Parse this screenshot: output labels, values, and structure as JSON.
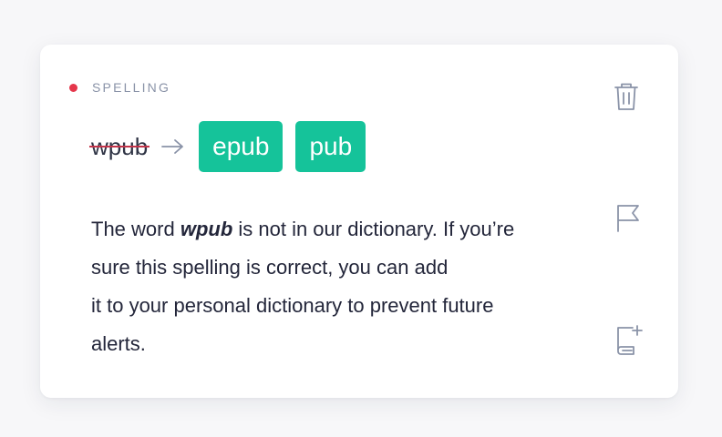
{
  "card": {
    "category": "SPELLING",
    "category_color": "#e5364b",
    "mistake": "wpub",
    "suggestions": [
      "epub",
      "pub"
    ],
    "accent": "#15c39a",
    "message": {
      "before": "The word ",
      "word": "wpub",
      "after_line1": " is not in our dictionary. If you’re",
      "line2": "sure this spelling is correct, you can add",
      "line3": "it to your personal dictionary to prevent future",
      "line4": "alerts."
    },
    "actions": {
      "delete_icon": "trash-icon",
      "flag_icon": "flag-icon",
      "add_dictionary_icon": "add-to-dictionary-icon"
    }
  }
}
